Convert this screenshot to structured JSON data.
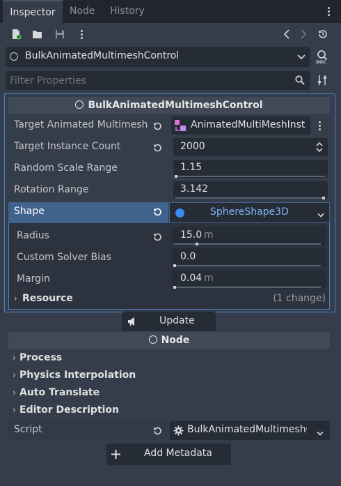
{
  "tabs": [
    {
      "label": "Inspector"
    },
    {
      "label": "Node"
    },
    {
      "label": "History"
    }
  ],
  "object_selector": {
    "value": "BulkAnimatedMultimeshControl"
  },
  "filter": {
    "placeholder": "Filter Properties"
  },
  "section_main": {
    "title": "BulkAnimatedMultimeshControl"
  },
  "props": {
    "target_multimesh": {
      "label": "Target Animated Multimesh",
      "value": "AnimatedMultiMeshInst"
    },
    "target_instance_count": {
      "label": "Target Instance Count",
      "value": "2000"
    },
    "random_scale_range": {
      "label": "Random Scale Range",
      "value": "1.15"
    },
    "rotation_range": {
      "label": "Rotation Range",
      "value": "3.142"
    },
    "shape": {
      "label": "Shape",
      "value": "SphereShape3D"
    }
  },
  "shape_props": {
    "radius": {
      "label": "Radius",
      "value": "15.0",
      "unit": "m"
    },
    "solver_bias": {
      "label": "Custom Solver Bias",
      "value": "0.0"
    },
    "margin": {
      "label": "Margin",
      "value": "0.04",
      "unit": "m"
    },
    "resource": {
      "label": "Resource",
      "changes": "(1 change)"
    }
  },
  "update_button": {
    "label": "Update"
  },
  "section_node": {
    "title": "Node"
  },
  "groups": [
    {
      "label": "Process"
    },
    {
      "label": "Physics Interpolation"
    },
    {
      "label": "Auto Translate"
    },
    {
      "label": "Editor Description"
    }
  ],
  "script": {
    "label": "Script",
    "value": "BulkAnimatedMultimeshC"
  },
  "add_metadata": {
    "label": "Add Metadata"
  },
  "colors": {
    "background": "#363d4a",
    "tab_bar": "#21262e",
    "field": "#262c36",
    "accent": "#4c83c5",
    "selected_row": "#41628c"
  }
}
